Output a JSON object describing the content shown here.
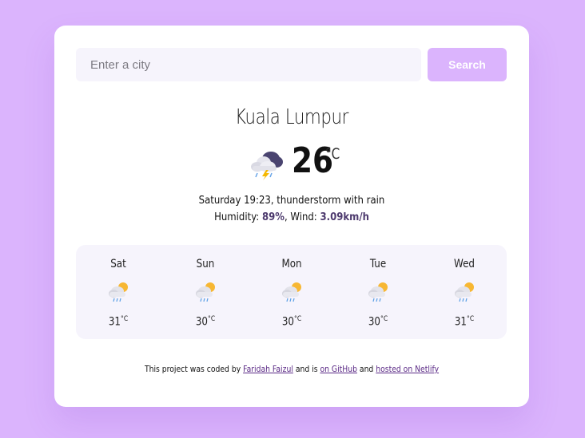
{
  "search": {
    "placeholder": "Enter a city",
    "button_label": "Search"
  },
  "current": {
    "city": "Kuala Lumpur",
    "temperature": "26",
    "unit": "°C",
    "icon": "thunderstorm-icon",
    "datetime": "Saturday 19:23",
    "description": "thunderstorm with rain",
    "humidity_label": "Humidity:",
    "humidity": "89%",
    "wind_label": "Wind:",
    "wind": "3.09km/h"
  },
  "forecast": [
    {
      "day": "Sat",
      "temp": "31",
      "unit": "°C",
      "icon": "partly-cloudy-rain-icon"
    },
    {
      "day": "Sun",
      "temp": "30",
      "unit": "°C",
      "icon": "partly-cloudy-rain-icon"
    },
    {
      "day": "Mon",
      "temp": "30",
      "unit": "°C",
      "icon": "partly-cloudy-rain-icon"
    },
    {
      "day": "Tue",
      "temp": "30",
      "unit": "°C",
      "icon": "partly-cloudy-rain-icon"
    },
    {
      "day": "Wed",
      "temp": "31",
      "unit": "°C",
      "icon": "partly-cloudy-rain-icon"
    }
  ],
  "footer": {
    "text_1": "This project was coded by",
    "author_link": "Faridah Faizul",
    "text_2": "and is",
    "github_link": "on GitHub",
    "text_3": "and",
    "netlify_link": "hosted on Netlify"
  },
  "colors": {
    "background": "#dbb4fd",
    "accent": "#dbb4fd",
    "highlight": "#4d3a6e",
    "link": "#5b2a86"
  }
}
